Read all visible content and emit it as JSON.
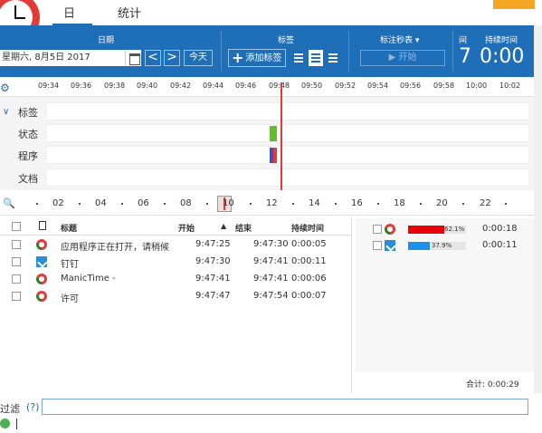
{
  "tabs": {
    "day": "日",
    "stats": "统计"
  },
  "header": {
    "date_label": "日期",
    "date_value": "星期六, 8月5日 2017",
    "prev_symbol": "<",
    "next_symbol": ">",
    "today_label": "今天",
    "tags_label": "标签",
    "add_tag_label": "添加标签",
    "add_tag_plus": "+",
    "stopwatch_label": "标注秒表 ▾",
    "start_label": "▶ 开始",
    "interval_label": "间",
    "interval_value": "7",
    "duration_label": "持续时间",
    "duration_value": "0:00"
  },
  "timeline": {
    "ticks": [
      "09:34",
      "09:36",
      "09:38",
      "09:40",
      "09:42",
      "09:44",
      "09:46",
      "09:48",
      "09:50",
      "09:52",
      "09:54",
      "09:56",
      "09:58",
      "10:00",
      "10:02"
    ],
    "tracks": [
      "标签",
      "状态",
      "程序",
      "文档"
    ],
    "colors": {
      "accent": "#1f6eb8",
      "now_line": "#e53935",
      "status_bar": "#66bb2e",
      "program_blue": "#3f51b5",
      "program_red": "#e53935"
    }
  },
  "overview": {
    "labels": [
      "02",
      "04",
      "06",
      "08",
      "10",
      "12",
      "14",
      "16",
      "18",
      "20",
      "22"
    ]
  },
  "table": {
    "headers": {
      "title": "标题",
      "start": "开始",
      "end": "结束",
      "duration": "持续时间"
    },
    "rows": [
      {
        "icon": "manictime-icon",
        "title": "应用程序正在打开，请稍候",
        "start": "9:47:25",
        "end": "9:47:30",
        "duration": "0:00:05"
      },
      {
        "icon": "pin-icon",
        "title": "钉钉",
        "start": "9:47:30",
        "end": "9:47:41",
        "duration": "0:00:11"
      },
      {
        "icon": "manictime-icon",
        "title": "ManicTime -",
        "start": "9:47:41",
        "end": "9:47:41",
        "duration": "0:00:06"
      },
      {
        "icon": "manictime-icon",
        "title": "许可",
        "start": "9:47:47",
        "end": "9:47:54",
        "duration": "0:00:07"
      }
    ]
  },
  "summary": {
    "rows": [
      {
        "icon": "manictime-icon",
        "percent": "62.1%",
        "fraction": 0.621,
        "color": "#e8000b",
        "time": "0:00:18"
      },
      {
        "icon": "pin-icon",
        "percent": "37.9%",
        "fraction": 0.379,
        "color": "#1e90e8",
        "time": "0:00:11"
      }
    ],
    "total": "合计: 0:00:29"
  },
  "filter": {
    "label": "过滤",
    "help": "(?)",
    "value": ""
  }
}
